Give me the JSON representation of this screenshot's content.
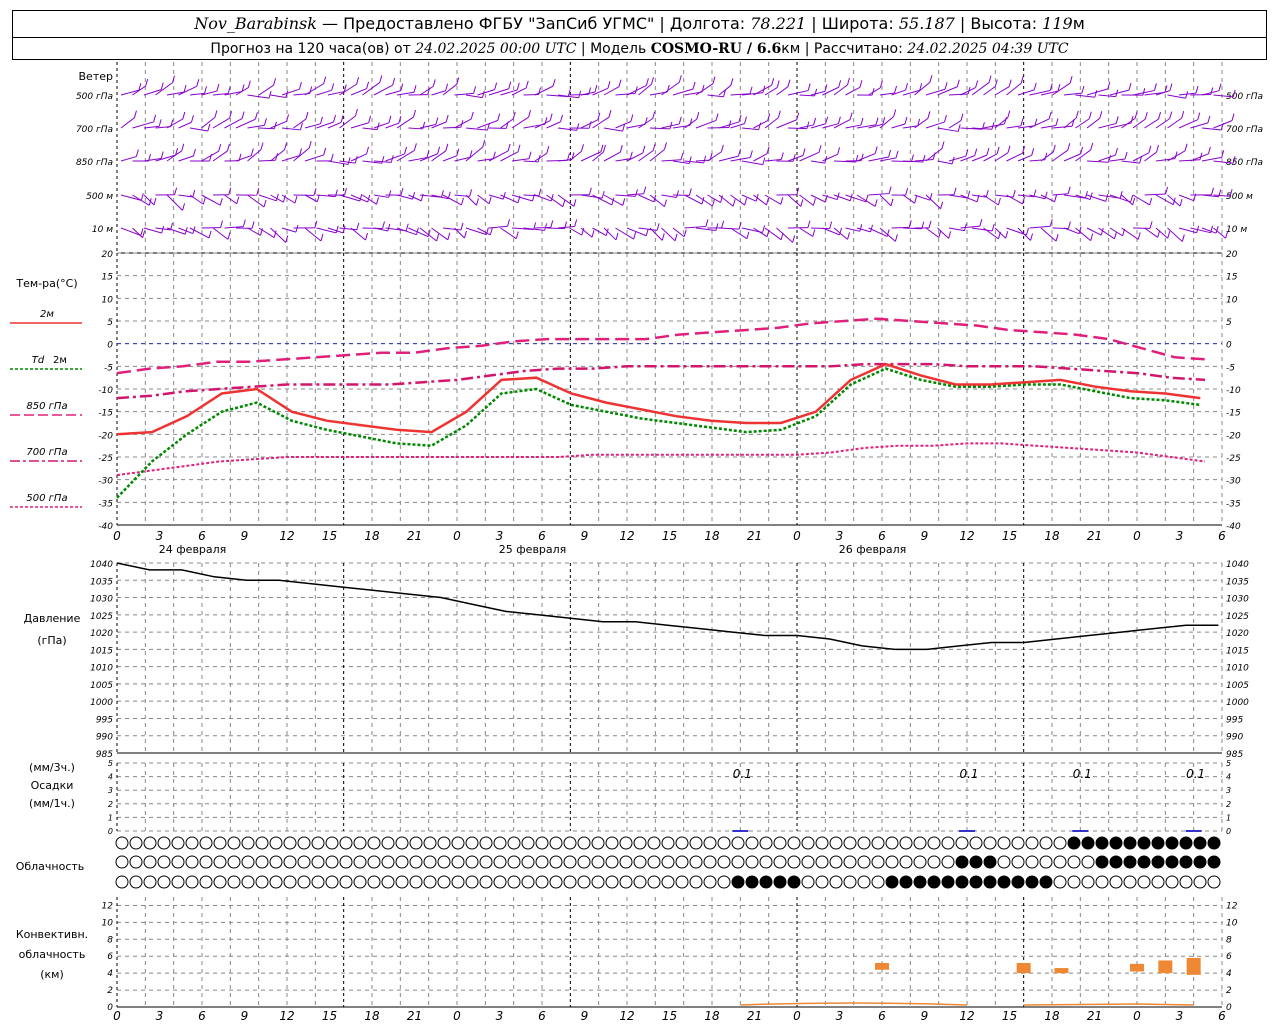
{
  "header": {
    "station": "Nov_Barabinsk",
    "provider": " — Предоставлено ФГБУ \"ЗапСиб УГМС\" | Долгота: ",
    "lon": "78.221",
    "lat_label": " | Широта: ",
    "lat": "55.187",
    "alt_label": " | Высота: ",
    "alt": "119",
    "alt_unit": "м",
    "forecast_label": "Прогноз на 120 часа(ов) от ",
    "init": "24.02.2025 00:00 UTC",
    "model_label": " | Модель ",
    "model": "COSMO-RU / 6.6",
    "model_unit": "км",
    "calc_label": " | Рассчитано: ",
    "calc": "24.02.2025 04:39 UTC"
  },
  "labels": {
    "wind": "Ветер",
    "wind_levels": [
      "500 гПа",
      "700 гПа",
      "850 гПа",
      "500 м",
      "10 м"
    ],
    "temp": "Тем-ра(°C)",
    "t2m": "2м",
    "td_a": "Td",
    "td_b": "2м",
    "t850": "850 гПа",
    "t700": "700 гПа",
    "t500": "500 гПа",
    "pressure": "Давление",
    "pressure_unit": "(гПа)",
    "precip_unit1": "(мм/3ч.)",
    "precip": "Осадки",
    "precip_unit2": "(мм/1ч.)",
    "cloud": "Облачность",
    "conv1": "Конвективн.",
    "conv2": "облачность",
    "conv3": "(км)"
  },
  "colors": {
    "t2m": "#ee3333",
    "td": "#008800",
    "t850": "#e0207a",
    "t700": "#d2166e",
    "t500": "#e0207a",
    "wind": "#8800cc",
    "pressure": "#000000",
    "zero_line": "#3333cc",
    "conv": "#ee8833",
    "grid": "#888888"
  },
  "chart_data": [
    {
      "type": "wind_barbs",
      "title": "Ветер",
      "levels": [
        "500 гПа",
        "700 гПа",
        "850 гПа",
        "500 м",
        "10 м"
      ]
    },
    {
      "type": "line",
      "title": "Тем-ра(°C)",
      "x_hours": [
        0,
        3,
        6,
        9,
        12,
        15,
        18,
        21,
        24,
        27,
        30,
        33,
        36,
        39,
        42,
        45,
        48,
        51,
        54,
        57,
        60,
        63,
        66,
        69,
        72,
        75,
        78,
        81,
        84,
        87,
        90,
        93,
        96,
        99,
        102,
        105,
        108,
        111,
        114,
        117
      ],
      "ylim": [
        -40,
        20
      ],
      "yticks": [
        -40,
        -35,
        -30,
        -25,
        -20,
        -15,
        -10,
        -5,
        0,
        5,
        10,
        15,
        20
      ],
      "series": [
        {
          "name": "2м",
          "values": [
            -20,
            -19.5,
            -16,
            -11,
            -10,
            -15,
            -17,
            -18,
            -19,
            -19.5,
            -15,
            -8,
            -7.5,
            -11,
            -13,
            -14.5,
            -16,
            -17,
            -17.5,
            -17.5,
            -15,
            -8,
            -4.5,
            -7,
            -9,
            -9,
            -8.5,
            -8,
            -9.5,
            -10.5,
            -11,
            -12
          ]
        },
        {
          "name": "Td 2м",
          "values": [
            -34,
            -26,
            -20,
            -15,
            -13,
            -17,
            -19,
            -20.5,
            -22,
            -22.5,
            -18,
            -11,
            -10,
            -13.5,
            -15,
            -16.5,
            -17.5,
            -18.5,
            -19.5,
            -19,
            -16,
            -9,
            -5.5,
            -8,
            -9.5,
            -9.5,
            -9,
            -9,
            -10.5,
            -12,
            -12.5,
            -13.5
          ]
        },
        {
          "name": "850 гПа",
          "values": [
            -6.5,
            -5.5,
            -5,
            -4,
            -4,
            -3.5,
            -3,
            -2.5,
            -2,
            -2,
            -1,
            -0.5,
            0.5,
            1,
            1,
            1,
            1,
            2,
            2.5,
            3,
            3.5,
            4.5,
            5,
            5.5,
            5,
            4.5,
            4,
            3,
            2.5,
            2,
            1,
            -1,
            -3,
            -3.5
          ]
        },
        {
          "name": "700 гПа",
          "values": [
            -12,
            -11.5,
            -10.5,
            -10,
            -9.5,
            -9,
            -9,
            -9,
            -9,
            -8.5,
            -8,
            -7,
            -6,
            -5.5,
            -5.5,
            -5,
            -5,
            -5,
            -5,
            -5,
            -5,
            -5,
            -4.5,
            -4.5,
            -4.5,
            -5,
            -5,
            -5,
            -5.5,
            -6,
            -6.5,
            -7.5,
            -8
          ]
        },
        {
          "name": "500 гПа",
          "values": [
            -29,
            -28,
            -27,
            -26,
            -25.5,
            -25,
            -25,
            -25,
            -25,
            -25,
            -25,
            -25,
            -25,
            -25,
            -24.5,
            -24.5,
            -24.5,
            -24.5,
            -24.5,
            -24.5,
            -24.5,
            -24,
            -23,
            -22.5,
            -22.5,
            -22,
            -22,
            -22.5,
            -23,
            -23.5,
            -24,
            -25,
            -26
          ]
        }
      ]
    },
    {
      "type": "line",
      "title": "Давление",
      "ylabel": "(гПа)",
      "ylim": [
        985,
        1040
      ],
      "yticks": [
        985,
        990,
        995,
        1000,
        1005,
        1010,
        1015,
        1020,
        1025,
        1030,
        1035,
        1040
      ],
      "series": [
        {
          "name": "Давление",
          "values": [
            1040,
            1038,
            1038,
            1036,
            1035,
            1035,
            1034,
            1033,
            1032,
            1031,
            1030,
            1028,
            1026,
            1025,
            1024,
            1023,
            1023,
            1022,
            1021,
            1020,
            1019,
            1019,
            1018,
            1016,
            1015,
            1015,
            1016,
            1017,
            1017,
            1018,
            1019,
            1020,
            1021,
            1022,
            1022
          ]
        }
      ]
    },
    {
      "type": "bar",
      "title": "Осадки",
      "ylim": [
        0,
        5
      ],
      "yticks": [
        0,
        1,
        2,
        3,
        4,
        5
      ],
      "annotations": [
        {
          "hour": 66,
          "text": "0.1"
        },
        {
          "hour": 90,
          "text": "0.1"
        },
        {
          "hour": 102,
          "text": "0.1"
        },
        {
          "hour": 114,
          "text": "0.1"
        }
      ]
    },
    {
      "type": "table",
      "title": "Облачность",
      "rows": [
        "high",
        "middle",
        "low"
      ]
    },
    {
      "type": "bar",
      "title": "Конвективн. облачность (км)",
      "ylim": [
        0,
        13
      ],
      "yticks": [
        0,
        2,
        4,
        6,
        8,
        10,
        12
      ],
      "values_km": [
        {
          "hour": 81,
          "base": 4.4,
          "top": 5.2
        },
        {
          "hour": 96,
          "base": 4.0,
          "top": 5.2
        },
        {
          "hour": 100,
          "base": 4.0,
          "top": 4.6
        },
        {
          "hour": 108,
          "base": 4.2,
          "top": 5.1
        },
        {
          "hour": 111,
          "base": 4.0,
          "top": 5.5
        },
        {
          "hour": 114,
          "base": 3.8,
          "top": 5.8
        }
      ]
    }
  ],
  "xaxis": {
    "ticks": [
      "0",
      "3",
      "6",
      "9",
      "12",
      "15",
      "18",
      "21",
      "0",
      "3",
      "6",
      "9",
      "12",
      "15",
      "18",
      "21",
      "0",
      "3",
      "6",
      "9",
      "12",
      "15",
      "18",
      "21",
      "0",
      "3",
      "6"
    ],
    "dates": [
      "24 февраля",
      "25 февраля",
      "26 февраля"
    ]
  }
}
